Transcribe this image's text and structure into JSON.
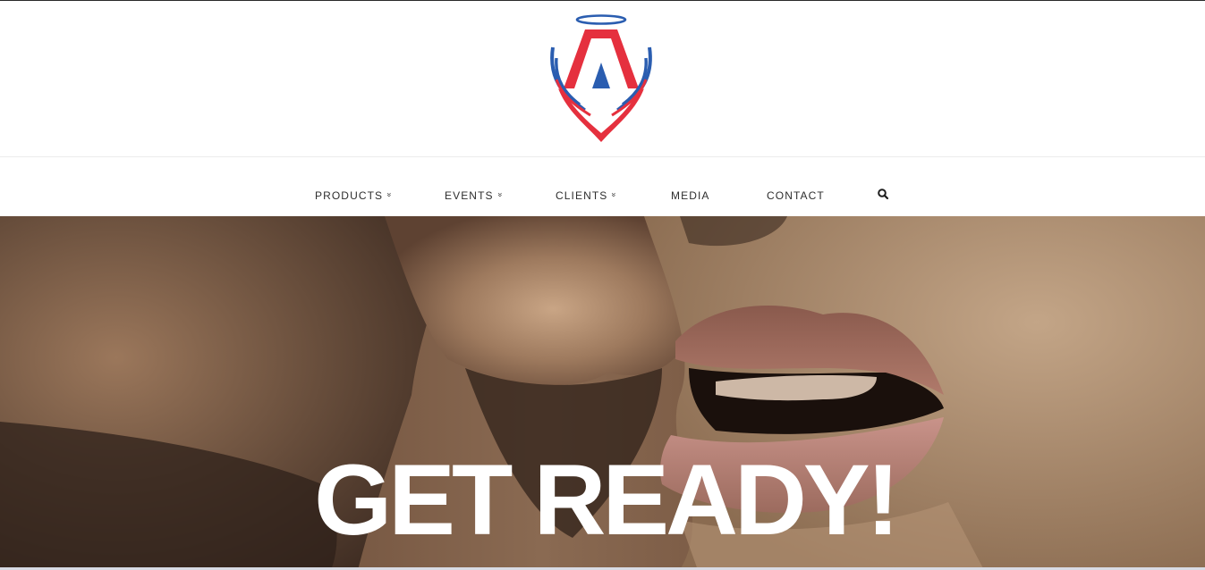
{
  "brand": {
    "logo_icon": "angel-wings-shield-logo",
    "colors": {
      "red": "#e5303e",
      "blue": "#2a5db0"
    }
  },
  "nav": {
    "items": [
      {
        "label": "PRODUCTS",
        "has_dropdown": true
      },
      {
        "label": "EVENTS",
        "has_dropdown": true
      },
      {
        "label": "CLIENTS",
        "has_dropdown": true
      },
      {
        "label": "MEDIA",
        "has_dropdown": false
      },
      {
        "label": "CONTACT",
        "has_dropdown": false
      }
    ],
    "dropdown_glyph": "»",
    "search_icon": "search-icon"
  },
  "hero": {
    "title": "GET READY!",
    "image": "close-up-faces-photo"
  }
}
